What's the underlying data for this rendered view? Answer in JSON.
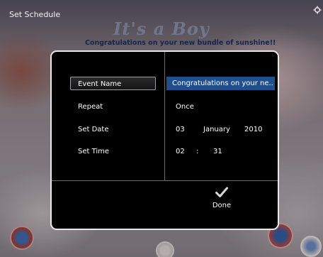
{
  "header": {
    "title": "Set Schedule",
    "settings_icon": "gear-icon"
  },
  "background": {
    "title": "It's a Boy",
    "subtitle": "Congratulations on your new bundle of sunshine!!"
  },
  "form": {
    "rows": [
      {
        "label": "Event Name",
        "value": "Congratulations on your ne..",
        "selected": true
      },
      {
        "label": "Repeat",
        "value": "Once"
      },
      {
        "label": "Set Date",
        "day": "03",
        "month": "January",
        "year": "2010"
      },
      {
        "label": "Set Time",
        "hour": "02",
        "separator": ":",
        "minute": "31"
      }
    ]
  },
  "actions": {
    "done_label": "Done",
    "done_icon": "checkmark-icon"
  },
  "colors": {
    "dialog_bg": "#000000",
    "dialog_border": "#e8e8e8",
    "highlight": "#1f4f8e"
  }
}
